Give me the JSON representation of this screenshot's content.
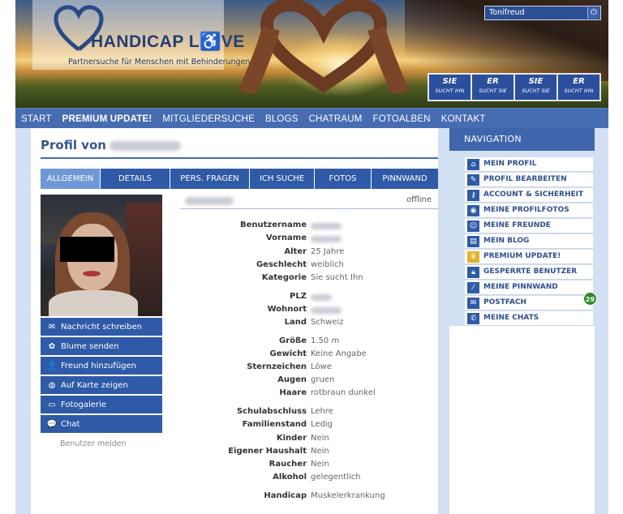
{
  "header": {
    "logo_text": "HANDICAP L",
    "logo_text_tail": "VE",
    "tagline": "Partnersuche für Menschen mit Behinderungen",
    "username": "Tonifreud",
    "search_tiles": [
      {
        "top": "SIE",
        "bottom": "SUCHT IHN"
      },
      {
        "top": "ER",
        "bottom": "SUCHT SIE"
      },
      {
        "top": "SIE",
        "bottom": "SUCHT SIE"
      },
      {
        "top": "ER",
        "bottom": "SUCHT IHN"
      }
    ]
  },
  "main_nav": [
    "START",
    "PREMIUM UPDATE!",
    "MITGLIEDERSUCHE",
    "BLOGS",
    "CHATRAUM",
    "FOTOALBEN",
    "KONTAKT"
  ],
  "profile": {
    "title": "Profil von",
    "status": "offline",
    "tabs": [
      "ALLGEMEIN",
      "DETAILS",
      "PERS. FRAGEN",
      "ICH SUCHE",
      "FOTOS",
      "PINNWAND"
    ],
    "actions": [
      "Nachricht schreiben",
      "Blume senden",
      "Freund hinzufügen",
      "Auf Karte zeigen",
      "Fotogalerie",
      "Chat"
    ],
    "report": "Benutzer melden",
    "fields": {
      "benutzername": {
        "label": "Benutzername"
      },
      "vorname": {
        "label": "Vorname"
      },
      "alter": {
        "label": "Alter",
        "value": "25 Jahre"
      },
      "geschlecht": {
        "label": "Geschlecht",
        "value": "weiblich"
      },
      "kategorie": {
        "label": "Kategorie",
        "value": "Sie sucht Ihn"
      },
      "plz": {
        "label": "PLZ"
      },
      "wohnort": {
        "label": "Wohnort"
      },
      "land": {
        "label": "Land",
        "value": "Schweiz"
      },
      "groesse": {
        "label": "Größe",
        "value": "1.50 m"
      },
      "gewicht": {
        "label": "Gewicht",
        "value": "Keine Angabe"
      },
      "sternzeichen": {
        "label": "Sternzeichen",
        "value": "Löwe"
      },
      "augen": {
        "label": "Augen",
        "value": "gruen"
      },
      "haare": {
        "label": "Haare",
        "value": "rotbraun dunkel"
      },
      "schulabschluss": {
        "label": "Schulabschluss",
        "value": "Lehre"
      },
      "familienstand": {
        "label": "Familienstand",
        "value": "Ledig"
      },
      "kinder": {
        "label": "Kinder",
        "value": "Nein"
      },
      "haushalt": {
        "label": "Eigener Haushalt",
        "value": "Nein"
      },
      "raucher": {
        "label": "Raucher",
        "value": "Nein"
      },
      "alkohol": {
        "label": "Alkohol",
        "value": "gelegentlich"
      },
      "handicap": {
        "label": "Handicap",
        "value": "Muskelerkrankung"
      }
    }
  },
  "navigation": {
    "title": "NAVIGATION",
    "items": [
      "MEIN PROFIL",
      "PROFIL BEARBEITEN",
      "ACCOUNT & SICHERHEIT",
      "MEINE PROFILFOTOS",
      "MEINE FREUNDE",
      "MEIN BLOG",
      "PREMIUM UPDATE!",
      "GESPERRTE BENUTZER",
      "MEINE PINNWAND",
      "POSTFACH",
      "MEINE CHATS"
    ],
    "postfach_badge": "29"
  }
}
